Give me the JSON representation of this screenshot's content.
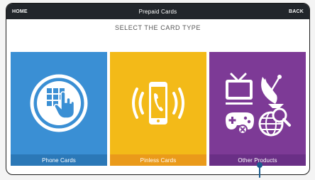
{
  "header": {
    "home_label": "HOME",
    "title": "Prepaid Cards",
    "back_label": "BACK"
  },
  "prompt": "SELECT THE CARD TYPE",
  "tiles": [
    {
      "label": "Phone Cards",
      "icon": "keypad-hand-icon",
      "color": "#3a8fd4"
    },
    {
      "label": "Pinless Cards",
      "icon": "ringing-phone-icon",
      "color": "#f3ba18"
    },
    {
      "label": "Other Products",
      "icons": [
        "tv-icon",
        "satellite-dish-icon",
        "gamepad-icon",
        "globe-search-icon"
      ],
      "color": "#7d3a96"
    }
  ]
}
